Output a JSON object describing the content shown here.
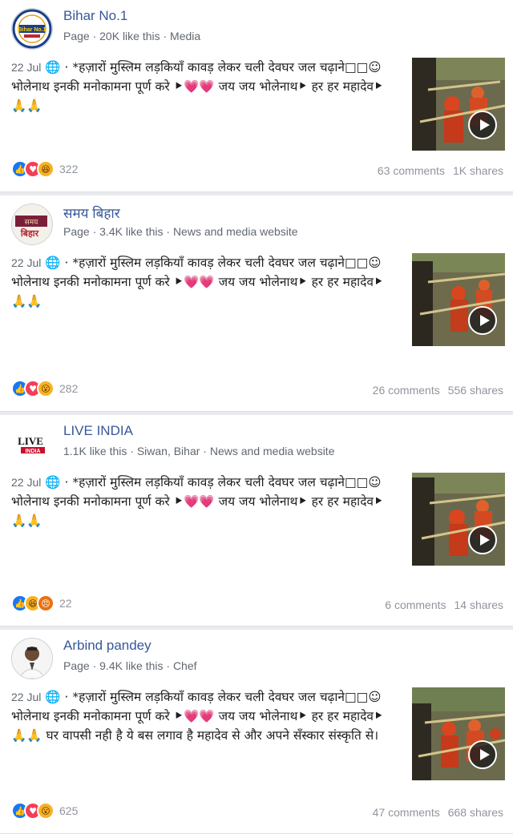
{
  "posts": [
    {
      "page_name": "Bihar No.1",
      "meta": "Page · 20K like this · Media",
      "date": "22 Jul",
      "text": "· *हज़ारों मुस्लिम लड़कियाँ कावड़ लेकर चली देवघर जल चढ़ाने□□☺ भोलेनाथ इनकी मनोकामना पूर्ण करे ⯈💗💗 जय जय भोलेनाथ⯈ हर हर महादेव⯈ 🙏🙏",
      "reaction_icons": [
        "like-icon",
        "love-icon",
        "haha-icon"
      ],
      "reactions_count": "322",
      "comments": "63 comments",
      "shares": "1K shares"
    },
    {
      "page_name": "समय बिहार",
      "meta": "Page · 3.4K like this · News and media website",
      "date": "22 Jul",
      "text": "· *हज़ारों मुस्लिम लड़कियाँ कावड़ लेकर चली देवघर जल चढ़ाने□□☺ भोलेनाथ इनकी मनोकामना पूर्ण करे ⯈💗💗 जय जय भोलेनाथ⯈ हर हर महादेव⯈ 🙏🙏",
      "reaction_icons": [
        "like-icon",
        "love-icon",
        "wow-icon"
      ],
      "reactions_count": "282",
      "comments": "26 comments",
      "shares": "556 shares"
    },
    {
      "page_name": "LIVE INDIA",
      "meta": "1.1K like this · Siwan, Bihar · News and media website",
      "date": "22 Jul",
      "text": "· *हज़ारों मुस्लिम लड़कियाँ कावड़ लेकर चली देवघर जल चढ़ाने□□☺ भोलेनाथ इनकी मनोकामना पूर्ण करे ⯈💗💗 जय जय भोलेनाथ⯈ हर हर महादेव⯈ 🙏🙏",
      "reaction_icons": [
        "like-icon",
        "haha-icon",
        "angry-icon"
      ],
      "reactions_count": "22",
      "comments": "6 comments",
      "shares": "14 shares"
    },
    {
      "page_name": "Arbind pandey",
      "meta": "Page · 9.4K like this · Chef",
      "date": "22 Jul",
      "text": "· *हज़ारों मुस्लिम लड़कियाँ कावड़ लेकर चली देवघर जल चढ़ाने□□☺ भोलेनाथ इनकी मनोकामना पूर्ण करे ⯈💗💗 जय जय भोलेनाथ⯈ हर हर महादेव⯈ 🙏🙏 घर वापसी नही है ये बस लगाव है महादेव से और अपने सँस्कार संस्कृति से।",
      "reaction_icons": [
        "like-icon",
        "love-icon",
        "wow-icon"
      ],
      "reactions_count": "625",
      "comments": "47 comments",
      "shares": "668 shares"
    }
  ],
  "colors": {
    "link_blue": "#385898",
    "like_blue": "#1877f2",
    "love_red": "#f33e58",
    "haha_yellow": "#f7b125",
    "angry_orange": "#e9710f",
    "muted_text": "#616770"
  },
  "avatars": {
    "bihar_no1_logo_text": "Bihar No.1",
    "samay_bihar_logo_text": "समय बिहार",
    "live_india_logo_text": "LIVE INDIA"
  }
}
